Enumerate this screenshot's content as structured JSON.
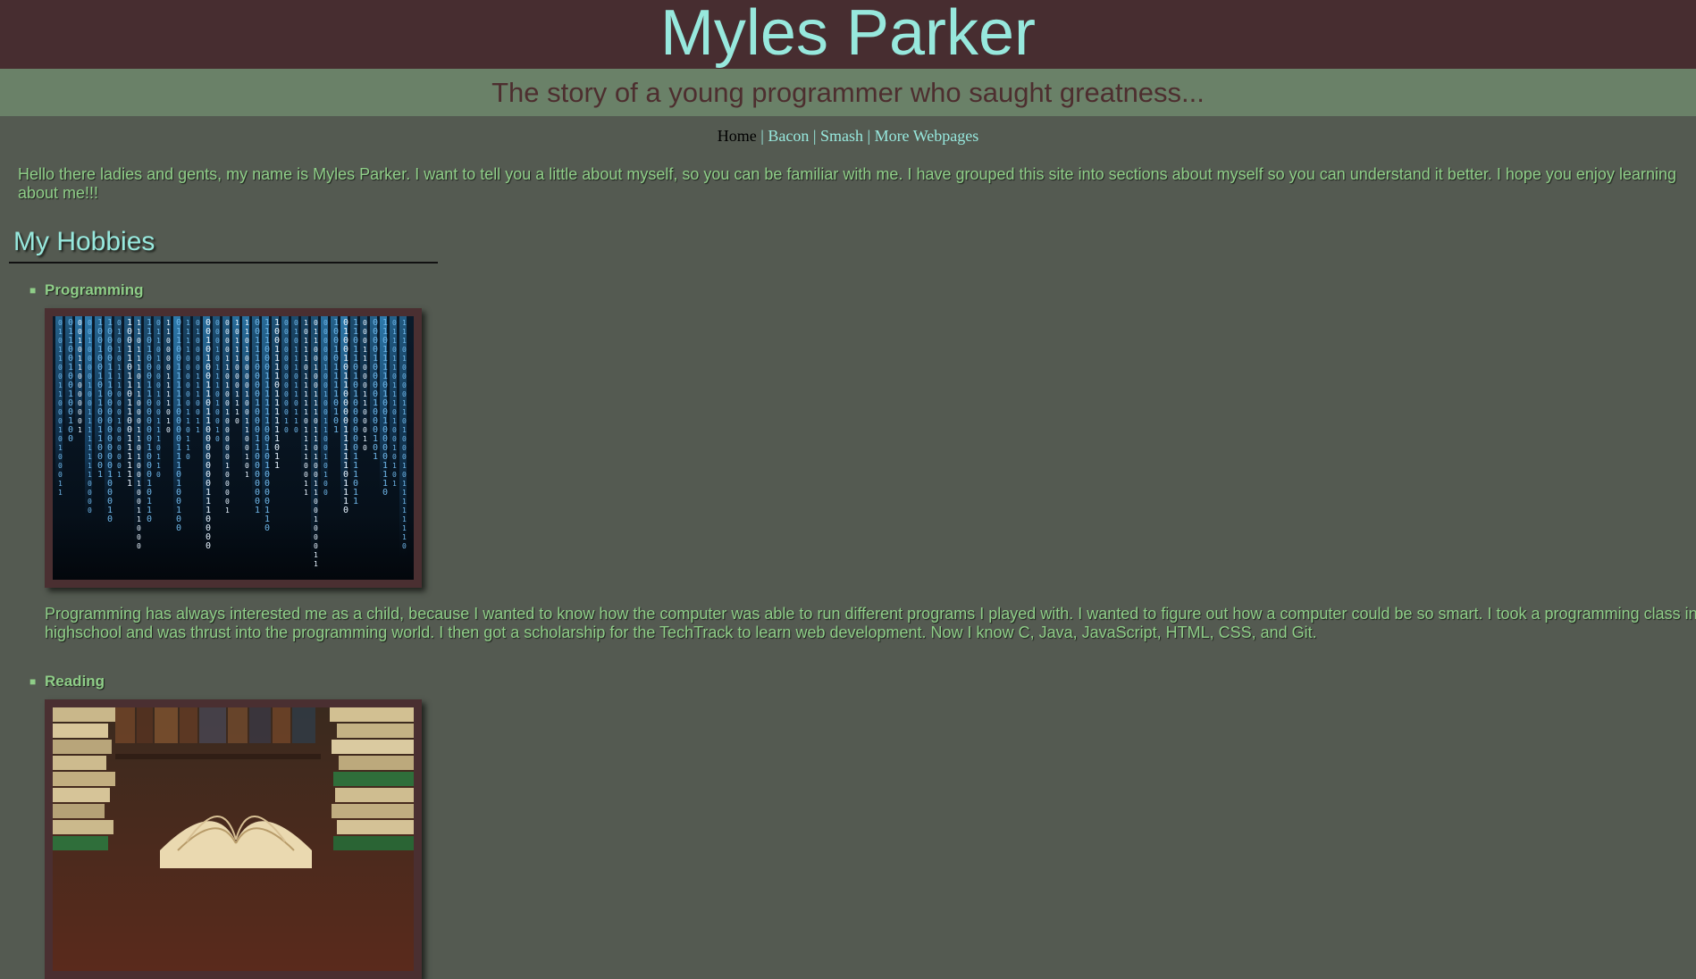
{
  "header": {
    "title": "Myles Parker"
  },
  "subheader": {
    "tagline": "The story of a young programmer who saught greatness..."
  },
  "nav": {
    "items": [
      {
        "label": "Home",
        "current": true
      },
      {
        "label": "Bacon"
      },
      {
        "label": "Smash"
      },
      {
        "label": "More Webpages"
      }
    ],
    "separator": "|"
  },
  "intro": {
    "line1": "Hello there ladies and gents, my name is Myles Parker. I want to tell you a little about myself, so you can be familiar with me. I have grouped this site into sections about myself so you can understand it better. I hope you enjoy learning",
    "line2": "about me!!!"
  },
  "hobbies_section": {
    "title": "My Hobbies",
    "items": [
      {
        "title": "Programming",
        "image": "binary-code-image",
        "desc_line1": "Programming has always interested me as a child, because I wanted to know how the computer was able to run different programs I played with. I wanted to figure out how a computer could be so smart. I took a programming class in",
        "desc_line2": "highschool and was thrust into the programming world. I then got a scholarship for the TechTrack to learn web development. Now I know C, Java, JavaScript, HTML, CSS, and Git."
      },
      {
        "title": "Reading",
        "image": "books-image"
      }
    ]
  },
  "colors": {
    "background": "#545a51",
    "header_bg": "#472d30",
    "subheader_bg": "#6a8168",
    "accent": "#97e8dd",
    "text_green": "#8fce88",
    "frame": "#4a2f31"
  }
}
